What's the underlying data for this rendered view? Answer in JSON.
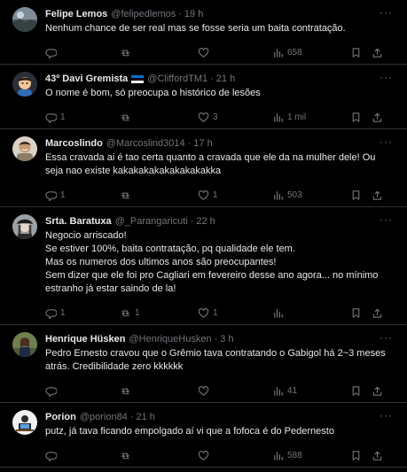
{
  "tweets": [
    {
      "name": "Felipe Lemos",
      "handle": "@felipedlemos",
      "time": "19 h",
      "text": "Nenhum chance de ser real mas se fosse seria um baita contratação.",
      "replies": "",
      "retweets": "",
      "likes": "",
      "views": "658",
      "avatar": "photo-landscape"
    },
    {
      "name": "43º Davi Gremista",
      "handle": "@CliffordTM1",
      "time": "21 h",
      "flag": "estonia-flag",
      "text": "O nome é bom, só preocupa o histórico de lesões",
      "replies": "1",
      "retweets": "",
      "likes": "3",
      "views": "1 mil",
      "avatar": "cartoon-boy"
    },
    {
      "name": "Marcoslindo",
      "handle": "@Marcoslind3014",
      "time": "17 h",
      "text": "Essa cravada ai é tao certa quanto a cravada que ele da na mulher dele! Ou seja nao existe kakakakakakakakakakka",
      "replies": "1",
      "retweets": "",
      "likes": "1",
      "views": "503",
      "avatar": "photo-man-smiling"
    },
    {
      "name": "Srta. Baratuxa",
      "handle": "@_Parangaricuti",
      "time": "22 h",
      "text": "Negocio arriscado!\nSe estiver 100%, baita contratação, pq qualidade ele tem.\nMas os numeros dos ultimos anos são preocupantes!\nSem dizer que ele foi pro Cagliari em fevereiro desse ano agora... no mínimo estranho já estar saindo de la!",
      "replies": "1",
      "retweets": "1",
      "likes": "1",
      "views": "",
      "avatar": "photo-woman-hat"
    },
    {
      "name": "Henrique Hüsken",
      "handle": "@HenriqueHusken",
      "time": "3 h",
      "text": "Pedro Ernesto cravou que o Grêmio tava contratando o Gabigol há 2~3 meses atrás. Credibilidade zero kkkkkk",
      "replies": "",
      "retweets": "",
      "likes": "",
      "views": "41",
      "avatar": "photo-woman-outdoor"
    },
    {
      "name": "Porion",
      "handle": "@porion84",
      "time": "21 h",
      "text": "putz, já tava ficando empolgado aí vi que a fofoca é do Pedernesto",
      "replies": "",
      "retweets": "",
      "likes": "",
      "views": "588",
      "avatar": "illustration-desk"
    }
  ],
  "icons": {
    "reply": "reply-icon",
    "retweet": "retweet-icon",
    "like": "heart-icon",
    "views": "views-icon",
    "bookmark": "bookmark-icon",
    "share": "share-icon",
    "more": "more-icon"
  },
  "colors": {
    "background": "#000000",
    "text": "#e7e9ea",
    "secondary": "#71767b",
    "border": "#2f3336"
  }
}
